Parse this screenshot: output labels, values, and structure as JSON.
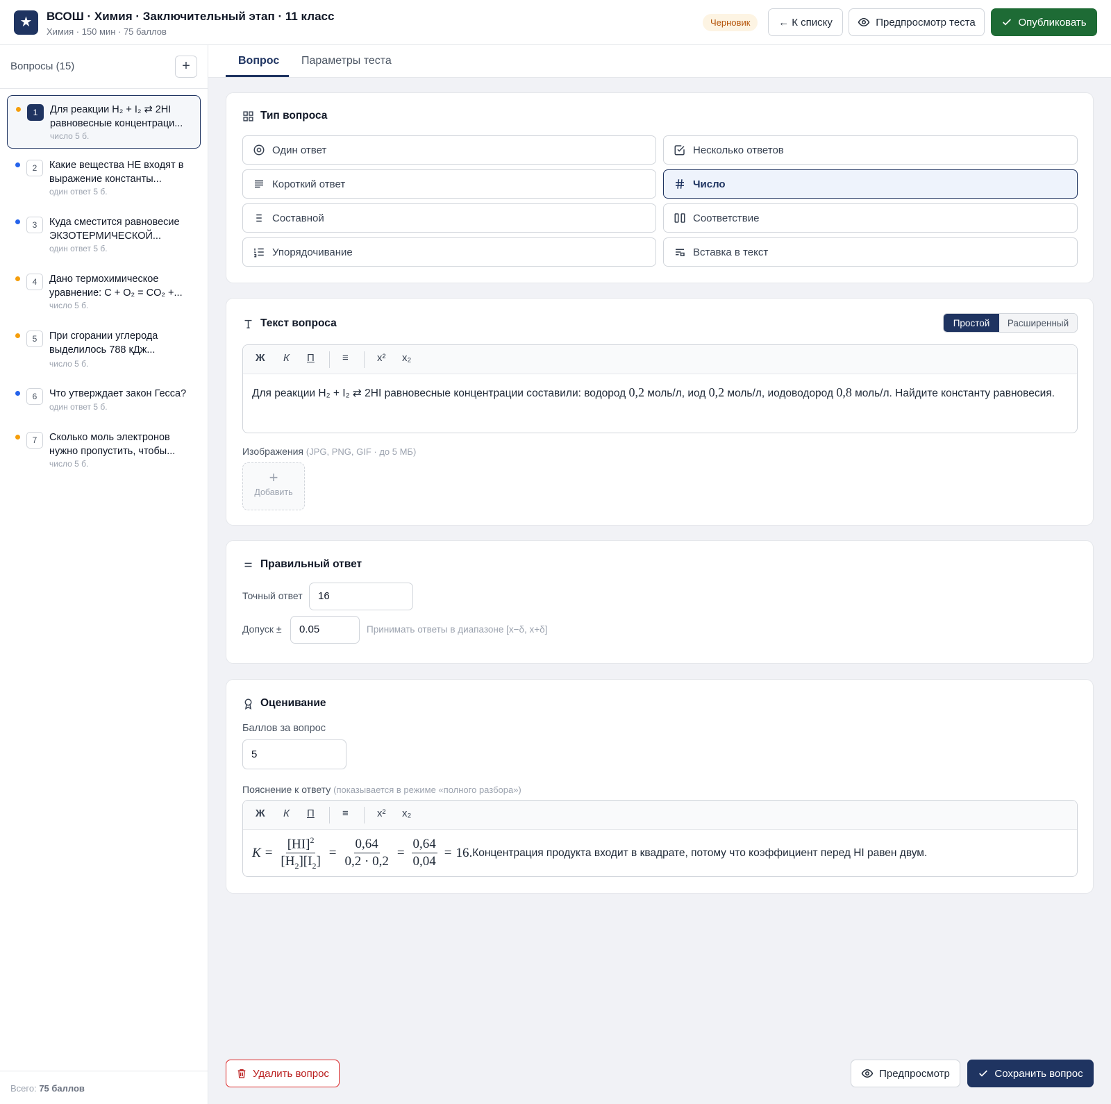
{
  "header": {
    "logo_glyph": "★",
    "title": "ВСОШ · Химия · Заключительный этап · 11 класс",
    "subtitle": "Химия · 150 мин · 75 баллов",
    "status_badge": "Черновик",
    "back_button": "← К списку",
    "preview_button": "Предпросмотр теста",
    "publish_button": "Опубликовать"
  },
  "sidebar": {
    "heading": "Вопросы (15)",
    "add_button": "+",
    "items": [
      {
        "num": "1",
        "line1": "Для реакции H₂ + I₂ ⇄ 2HI",
        "line2": "равновесные концентраци...",
        "meta": "число  5 б.",
        "dot": "#f59e0b",
        "active": true
      },
      {
        "num": "2",
        "line1": "Какие вещества НЕ входят в",
        "line2": "выражение константы...",
        "meta": "один ответ  5 б.",
        "dot": "#2563eb"
      },
      {
        "num": "3",
        "line1": "Куда сместится равновесие",
        "line2": "ЭКЗОТЕРМИЧЕСКОЙ...",
        "meta": "один ответ  5 б.",
        "dot": "#2563eb"
      },
      {
        "num": "4",
        "line1": "Дано термохимическое",
        "line2": "уравнение: C + O₂ = CO₂ +...",
        "meta": "число  5 б.",
        "dot": "#f59e0b"
      },
      {
        "num": "5",
        "line1": "При сгорании углерода",
        "line2": "выделилось 788 кДж...",
        "meta": "число  5 б.",
        "dot": "#f59e0b"
      },
      {
        "num": "6",
        "line1": "Что утверждает закон Гесса?",
        "line2": "",
        "meta": "один ответ  5 б.",
        "dot": "#2563eb"
      },
      {
        "num": "7",
        "line1": "Сколько моль электронов",
        "line2": "нужно пропустить, чтобы...",
        "meta": "число  5 б.",
        "dot": "#f59e0b"
      }
    ],
    "footer_prefix": "Всего: ",
    "footer_value": "75 баллов"
  },
  "tabs": [
    {
      "label": "Вопрос",
      "active": true
    },
    {
      "label": "Параметры теста",
      "active": false
    }
  ],
  "question_type": {
    "title": "Тип вопроса",
    "options": [
      {
        "label": "Один ответ",
        "icon": "radio-icon"
      },
      {
        "label": "Несколько ответов",
        "icon": "checkbox-icon"
      },
      {
        "label": "Короткий ответ",
        "icon": "lines-icon"
      },
      {
        "label": "Число",
        "icon": "hash-icon",
        "selected": true
      },
      {
        "label": "Составной",
        "icon": "list-icon"
      },
      {
        "label": "Соответствие",
        "icon": "columns-icon"
      },
      {
        "label": "Упорядочивание",
        "icon": "ordered-list-icon"
      },
      {
        "label": "Вставка в текст",
        "icon": "text-insert-icon"
      }
    ]
  },
  "question_text": {
    "title": "Текст вопроса",
    "mode_simple": "Простой",
    "mode_advanced": "Расширенный",
    "toolbar": {
      "bold": "Ж",
      "italic": "К",
      "underline": "П",
      "list": "≡",
      "sup": "x²",
      "sub": "x₂"
    },
    "body_part1": "Для реакции H₂ + I₂ ⇄ 2HI равновесные концентрации составили: водород ",
    "val1": "0,2",
    "body_part2": " моль/л, иод ",
    "val2": "0,2",
    "body_part3": " моль/л, иодоводород ",
    "val3": "0,8",
    "body_part4": " моль/л. Найдите константу равновесия.",
    "images_label": "Изображения",
    "images_hint": "(JPG, PNG, GIF · до 5 МБ)",
    "add_image_plus": "+",
    "add_image_label": "Добавить"
  },
  "correct_answer": {
    "title": "Правильный ответ",
    "exact_label": "Точный ответ",
    "exact_value": "16",
    "tolerance_label": "Допуск ±",
    "tolerance_value": "0.05",
    "tolerance_hint": "Принимать ответы в диапазоне [x−δ, x+δ]"
  },
  "grading": {
    "title": "Оценивание",
    "points_label": "Баллов за вопрос",
    "points_value": "5",
    "explanation_label": "Пояснение к ответу",
    "explanation_hint": "(показывается в режиме «полного разбора»)",
    "formula": {
      "k": "K",
      "eq": "=",
      "num1": "[HI]",
      "num1_sup": "2",
      "den1a": "[H",
      "den1a_sub": "2",
      "den1b": "][I",
      "den1b_sub": "2",
      "den1c": "]",
      "num2": "0,64",
      "den2": "0,2 · 0,2",
      "num3": "0,64",
      "den3": "0,04",
      "result": "16."
    },
    "explanation_text": " Концентрация продукта входит в квадрате, потому что коэффициент перед HI равен двум."
  },
  "footer_buttons": {
    "delete": "Удалить вопрос",
    "preview": "Предпросмотр",
    "save": "Сохранить вопрос"
  },
  "colors": {
    "primary": "#1f3461",
    "publish": "#1e6b35",
    "danger": "#dc2626",
    "draft_badge_bg": "#fdf4e3",
    "draft_badge_text": "#b45309"
  }
}
